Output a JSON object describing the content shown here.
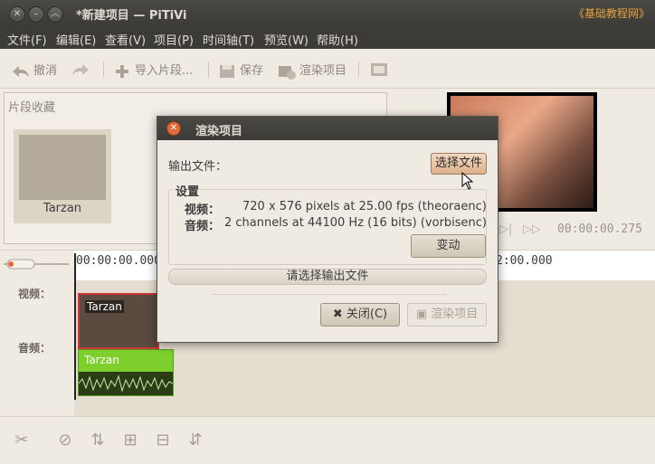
{
  "window": {
    "title": "*新建项目 — PiTiVi",
    "watermark": "《基础教程网》"
  },
  "menubar": [
    "文件(F)",
    "编辑(E)",
    "查看(V)",
    "项目(P)",
    "时间轴(T)",
    "预览(W)",
    "帮助(H)"
  ],
  "toolbar": {
    "undo": "撤消",
    "import": "导入片段...",
    "save": "保存",
    "render": "渲染项目"
  },
  "library": {
    "title": "片段收藏",
    "clip_name": "Tarzan"
  },
  "viewer": {
    "timecode": "00:00:00.275"
  },
  "timeline": {
    "start_tc": "00:00:00.000",
    "mark_tc": "2:00.000",
    "video_label": "视频：",
    "audio_label": "音频：",
    "video_clip": "Tarzan",
    "audio_clip": "Tarzan"
  },
  "dialog": {
    "title": "渲染项目",
    "output_label": "输出文件：",
    "choose_button": "选择文件",
    "settings_title": "设置",
    "video_key": "视频：",
    "video_value": "720 x 576 pixels at 25.00 fps (theoraenc)",
    "audio_key": "音频：",
    "audio_value": "2 channels at 44100 Hz (16 bits) (vorbisenc)",
    "change_button": "变动",
    "progress_text": "请选择输出文件",
    "close_button": "关闭(C)",
    "render_button": "渲染项目"
  },
  "colors": {
    "accent": "#dcb08c",
    "watermark": "#e8a23a",
    "audio_clip": "#7ccf2c"
  }
}
